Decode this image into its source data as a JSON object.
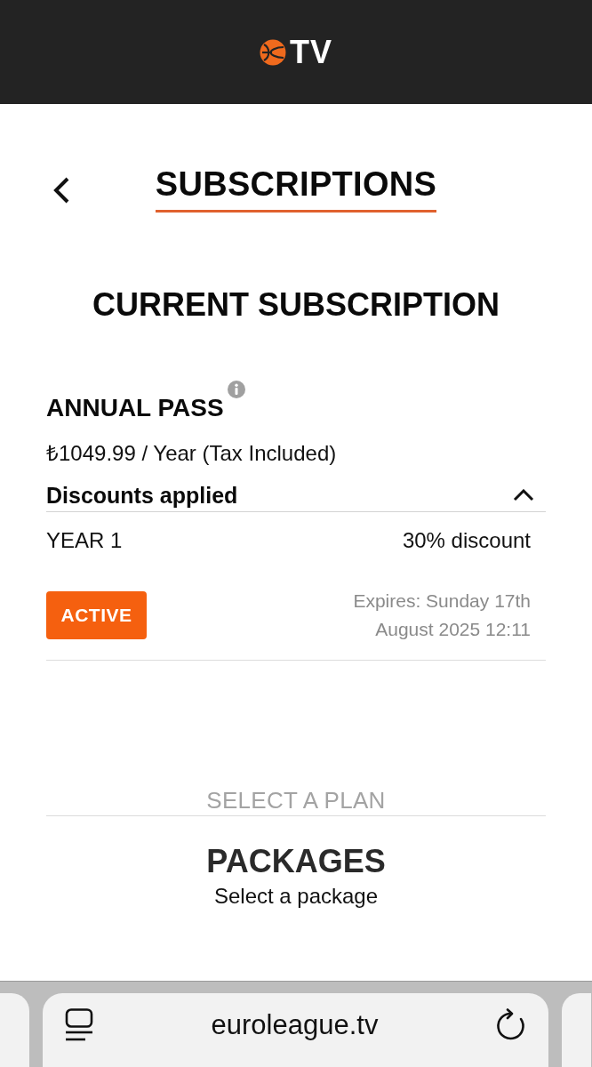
{
  "header": {
    "logo_text": "TV"
  },
  "page": {
    "title": "SUBSCRIPTIONS"
  },
  "current_subscription": {
    "heading": "CURRENT SUBSCRIPTION",
    "plan_name": "ANNUAL PASS",
    "price": "₺1049.99 / Year (Tax Included)",
    "discounts": {
      "label": "Discounts applied",
      "expanded": true,
      "items": [
        {
          "period": "YEAR 1",
          "discount": "30% discount"
        }
      ]
    },
    "status": {
      "label": "ACTIVE"
    },
    "expiry": "Expires: Sunday 17th August 2025 12:11"
  },
  "plans": {
    "divider_label": "SELECT A PLAN",
    "heading": "PACKAGES",
    "subheading": "Select a package"
  },
  "browser_bar": {
    "url": "euroleague.tv"
  }
}
